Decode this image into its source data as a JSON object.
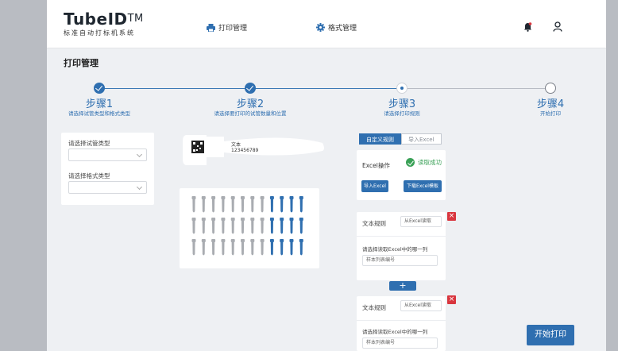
{
  "header": {
    "logo_title": "TubeID",
    "logo_tm": "TM",
    "logo_subtitle": "标准自动打标机系统",
    "nav_print": "打印管理",
    "nav_format": "格式管理"
  },
  "page": {
    "title": "打印管理"
  },
  "steps": [
    {
      "title": "步骤1",
      "subtitle": "请选择试管类型和格式类型",
      "status": "done"
    },
    {
      "title": "步骤2",
      "subtitle": "请选择要打印的试管数量和位置",
      "status": "done"
    },
    {
      "title": "步骤3",
      "subtitle": "请选择打印规则",
      "status": "current"
    },
    {
      "title": "步骤4",
      "subtitle": "开始打印",
      "status": "todo"
    }
  ],
  "left_panel": {
    "tube_type_label": "请选择试管类型",
    "format_type_label": "请选择格式类型"
  },
  "label_preview": {
    "text_line1": "文本",
    "text_line2": "123456789"
  },
  "tube_grid": {
    "rows": 3,
    "columns": 12,
    "selected_columns": [
      9,
      10,
      11,
      12
    ]
  },
  "rule_panel": {
    "tab_custom": "自定义规则",
    "tab_import": "导入Excel",
    "excel_op_label": "Excel操作",
    "excel_status": "读取成功",
    "import_button": "导入Excel",
    "download_button": "下载Excel模板",
    "rules": [
      {
        "label": "文本规则",
        "select": "从Excel读取",
        "question": "请选择读取Excel中的哪一列",
        "input": "样本列表编号"
      },
      {
        "label": "文本规则",
        "select": "从Excel读取",
        "question": "请选择读取Excel中的哪一列",
        "input": "样本列表编号"
      }
    ],
    "add_label": "+",
    "delete_label": "×"
  },
  "start_button": "开始打印",
  "colors": {
    "primary": "#2f6fb0",
    "success": "#3aa157",
    "danger": "#d9363e",
    "tube_grey": "#a9acb1"
  }
}
